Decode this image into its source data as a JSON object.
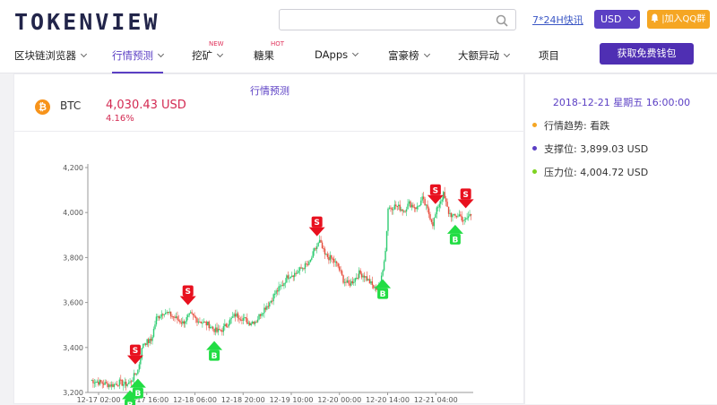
{
  "header": {
    "logo": "TOKENVIEW",
    "search_placeholder": "",
    "quick_news": "7*24H快讯",
    "currency": "USD",
    "qq_label": "|加入QQ群"
  },
  "nav": {
    "items": [
      {
        "label": "区块链浏览器",
        "dropdown": true
      },
      {
        "label": "行情预测",
        "dropdown": true,
        "active": true
      },
      {
        "label": "挖矿",
        "dropdown": true,
        "badge": "NEW"
      },
      {
        "label": "糖果",
        "dropdown": false,
        "badge": "HOT"
      },
      {
        "label": "DApps",
        "dropdown": true
      },
      {
        "label": "富豪榜",
        "dropdown": true
      },
      {
        "label": "大额异动",
        "dropdown": true
      },
      {
        "label": "项目",
        "dropdown": false
      }
    ],
    "wallet_button": "获取免费钱包"
  },
  "main": {
    "title": "行情预测",
    "coin": {
      "icon": "bitcoin-icon",
      "symbol_glyph": "₿",
      "name": "BTC",
      "price": "4,030.43 USD",
      "change": "4.16%"
    }
  },
  "side": {
    "datetime": "2018-12-21 星期五 16:00:00",
    "trend_label": "行情趋势: 看跌",
    "support_label": "支撑位: 3,899.03 USD",
    "resistance_label": "压力位: 4,004.72 USD",
    "colors": {
      "trend": "#f5a623",
      "support": "#5b3fc4",
      "resistance": "#7ed321"
    }
  },
  "chart_data": {
    "type": "candlestick",
    "yticks": [
      "4,200",
      "4,000",
      "3,800",
      "3,600",
      "3,400",
      "3,200"
    ],
    "ytick_values": [
      4200,
      4000,
      3800,
      3600,
      3400,
      3200
    ],
    "xticks": [
      "12-17 02:00",
      "12-17 16:00",
      "12-18 06:00",
      "12-18 20:00",
      "12-19 10:00",
      "12-20 00:00",
      "12-20 14:00",
      "12-21 04:00"
    ],
    "ylim": [
      3200,
      4200
    ],
    "up_color": "#2ecc71",
    "down_color": "#e74c3c",
    "anchors": [
      [
        0,
        3255
      ],
      [
        10,
        3240
      ],
      [
        16,
        3232
      ],
      [
        22,
        3245
      ],
      [
        26,
        3235
      ],
      [
        30,
        3245
      ],
      [
        36,
        3300
      ],
      [
        40,
        3420
      ],
      [
        46,
        3430
      ],
      [
        50,
        3530
      ],
      [
        56,
        3560
      ],
      [
        62,
        3540
      ],
      [
        70,
        3510
      ],
      [
        76,
        3545
      ],
      [
        82,
        3520
      ],
      [
        90,
        3500
      ],
      [
        96,
        3470
      ],
      [
        100,
        3480
      ],
      [
        106,
        3520
      ],
      [
        110,
        3545
      ],
      [
        116,
        3530
      ],
      [
        120,
        3510
      ],
      [
        126,
        3520
      ],
      [
        130,
        3560
      ],
      [
        136,
        3600
      ],
      [
        140,
        3640
      ],
      [
        146,
        3680
      ],
      [
        150,
        3720
      ],
      [
        156,
        3730
      ],
      [
        162,
        3760
      ],
      [
        166,
        3770
      ],
      [
        170,
        3830
      ],
      [
        174,
        3870
      ],
      [
        178,
        3810
      ],
      [
        184,
        3790
      ],
      [
        188,
        3760
      ],
      [
        192,
        3700
      ],
      [
        196,
        3680
      ],
      [
        200,
        3700
      ],
      [
        204,
        3730
      ],
      [
        208,
        3720
      ],
      [
        212,
        3690
      ],
      [
        216,
        3660
      ],
      [
        220,
        3680
      ],
      [
        224,
        3830
      ],
      [
        226,
        4020
      ],
      [
        232,
        4030
      ],
      [
        238,
        4010
      ],
      [
        242,
        4040
      ],
      [
        248,
        4020
      ],
      [
        252,
        4060
      ],
      [
        256,
        4010
      ],
      [
        260,
        3950
      ],
      [
        264,
        4030
      ],
      [
        268,
        4080
      ],
      [
        272,
        4000
      ],
      [
        276,
        3980
      ],
      [
        280,
        3990
      ],
      [
        284,
        3960
      ],
      [
        288,
        3990
      ]
    ],
    "signals": [
      {
        "type": "B",
        "index": 30
      },
      {
        "type": "S",
        "index": 34
      },
      {
        "type": "B",
        "index": 36
      },
      {
        "type": "S",
        "index": 74
      },
      {
        "type": "B",
        "index": 94
      },
      {
        "type": "S",
        "index": 172
      },
      {
        "type": "B",
        "index": 222
      },
      {
        "type": "S",
        "index": 262
      },
      {
        "type": "B",
        "index": 277
      },
      {
        "type": "S",
        "index": 285
      }
    ]
  }
}
